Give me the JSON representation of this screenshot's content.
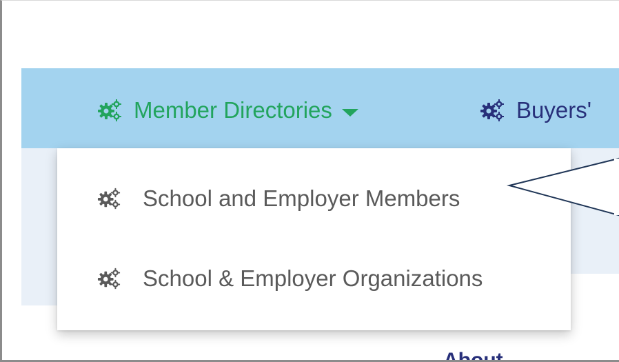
{
  "nav": {
    "member_directories_label": "Member Directories",
    "buyers_label": "Buyers'",
    "member_color": "#22a45d",
    "buyers_color": "#28307a",
    "bar_color": "#a3d3ef"
  },
  "dropdown": {
    "items": [
      {
        "label": "School and Employer Members",
        "icon": "gears-icon"
      },
      {
        "label": "School & Employer Organizations",
        "icon": "gears-icon"
      }
    ]
  },
  "footer": {
    "partial_label": "About"
  }
}
